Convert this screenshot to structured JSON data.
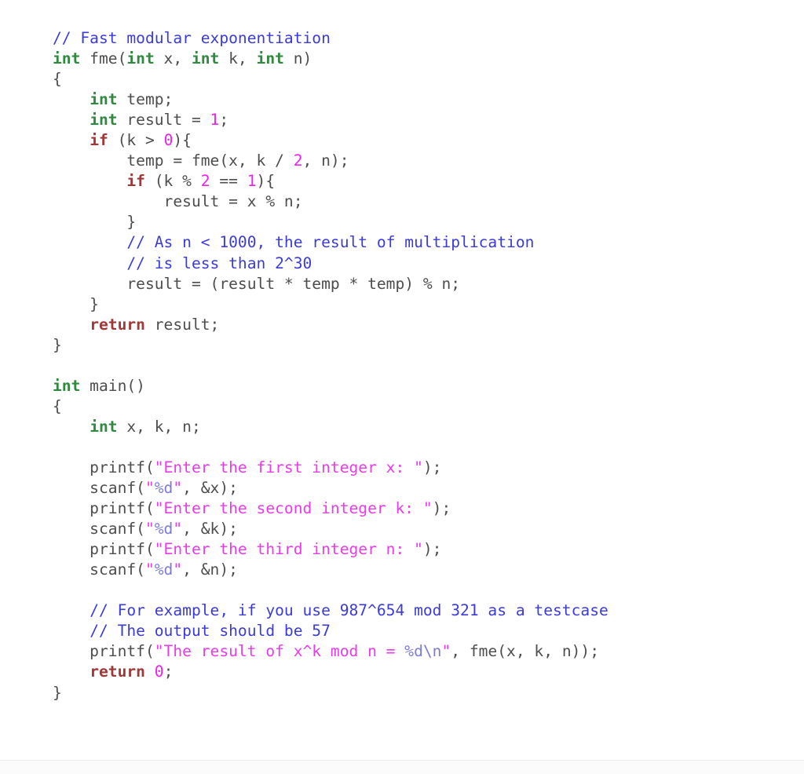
{
  "document": {
    "language": "C",
    "title": "Fast modular exponentiation",
    "background_color": "#ffffff",
    "divider_color": "#ececed",
    "strip_color": "#fbfbfc"
  },
  "theme": {
    "plain": "#4d4d4d",
    "comment": "#3b3bdb",
    "type": "#2f8a3f",
    "keyword": "#a03838",
    "number": "#f020f0",
    "string": "#ea3bea",
    "escape": "#7b7bdb"
  },
  "code": {
    "plain_text": "// Fast modular exponentiation\nint fme(int x, int k, int n)\n{\n    int temp;\n    int result = 1;\n    if (k > 0){\n        temp = fme(x, k / 2, n);\n        if (k % 2 == 1){\n            result = x % n;\n        }\n        // As n < 1000, the result of multiplication\n        // is less than 2^30\n        result = (result * temp * temp) % n;\n    }\n    return result;\n}\n\nint main()\n{\n    int x, k, n;\n\n    printf(\"Enter the first integer x: \");\n    scanf(\"%d\", &x);\n    printf(\"Enter the second integer k: \");\n    scanf(\"%d\", &k);\n    printf(\"Enter the third integer n: \");\n    scanf(\"%d\", &n);\n\n    // For example, if you use 987^654 mod 321 as a testcase\n    // The output should be 57\n    printf(\"The result of x^k mod n = %d\\n\", fme(x, k, n));\n    return 0;\n}",
    "lines": [
      {
        "n": 1,
        "tokens": [
          {
            "t": "comment",
            "s": "// Fast modular exponentiation"
          }
        ]
      },
      {
        "n": 2,
        "tokens": [
          {
            "t": "type",
            "s": "int"
          },
          {
            "t": "plain",
            "s": " fme("
          },
          {
            "t": "type",
            "s": "int"
          },
          {
            "t": "plain",
            "s": " x, "
          },
          {
            "t": "type",
            "s": "int"
          },
          {
            "t": "plain",
            "s": " k, "
          },
          {
            "t": "type",
            "s": "int"
          },
          {
            "t": "plain",
            "s": " n)"
          }
        ]
      },
      {
        "n": 3,
        "tokens": [
          {
            "t": "plain",
            "s": "{"
          }
        ]
      },
      {
        "n": 4,
        "tokens": [
          {
            "t": "plain",
            "s": "    "
          },
          {
            "t": "type",
            "s": "int"
          },
          {
            "t": "plain",
            "s": " temp;"
          }
        ]
      },
      {
        "n": 5,
        "tokens": [
          {
            "t": "plain",
            "s": "    "
          },
          {
            "t": "type",
            "s": "int"
          },
          {
            "t": "plain",
            "s": " result = "
          },
          {
            "t": "number",
            "s": "1"
          },
          {
            "t": "plain",
            "s": ";"
          }
        ]
      },
      {
        "n": 6,
        "tokens": [
          {
            "t": "plain",
            "s": "    "
          },
          {
            "t": "keyword",
            "s": "if"
          },
          {
            "t": "plain",
            "s": " (k > "
          },
          {
            "t": "number",
            "s": "0"
          },
          {
            "t": "plain",
            "s": "){"
          }
        ]
      },
      {
        "n": 7,
        "tokens": [
          {
            "t": "plain",
            "s": "        temp = fme(x, k / "
          },
          {
            "t": "number",
            "s": "2"
          },
          {
            "t": "plain",
            "s": ", n);"
          }
        ]
      },
      {
        "n": 8,
        "tokens": [
          {
            "t": "plain",
            "s": "        "
          },
          {
            "t": "keyword",
            "s": "if"
          },
          {
            "t": "plain",
            "s": " (k % "
          },
          {
            "t": "number",
            "s": "2"
          },
          {
            "t": "plain",
            "s": " == "
          },
          {
            "t": "number",
            "s": "1"
          },
          {
            "t": "plain",
            "s": "){"
          }
        ]
      },
      {
        "n": 9,
        "tokens": [
          {
            "t": "plain",
            "s": "            result = x % n;"
          }
        ]
      },
      {
        "n": 10,
        "tokens": [
          {
            "t": "plain",
            "s": "        }"
          }
        ]
      },
      {
        "n": 11,
        "tokens": [
          {
            "t": "plain",
            "s": "        "
          },
          {
            "t": "comment",
            "s": "// As n < 1000, the result of multiplication"
          }
        ]
      },
      {
        "n": 12,
        "tokens": [
          {
            "t": "plain",
            "s": "        "
          },
          {
            "t": "comment",
            "s": "// is less than 2^30"
          }
        ]
      },
      {
        "n": 13,
        "tokens": [
          {
            "t": "plain",
            "s": "        result = (result * temp * temp) % n;"
          }
        ]
      },
      {
        "n": 14,
        "tokens": [
          {
            "t": "plain",
            "s": "    }"
          }
        ]
      },
      {
        "n": 15,
        "tokens": [
          {
            "t": "plain",
            "s": "    "
          },
          {
            "t": "keyword",
            "s": "return"
          },
          {
            "t": "plain",
            "s": " result;"
          }
        ]
      },
      {
        "n": 16,
        "tokens": [
          {
            "t": "plain",
            "s": "}"
          }
        ]
      },
      {
        "n": 17,
        "tokens": [
          {
            "t": "plain",
            "s": ""
          }
        ]
      },
      {
        "n": 18,
        "tokens": [
          {
            "t": "type",
            "s": "int"
          },
          {
            "t": "plain",
            "s": " main()"
          }
        ]
      },
      {
        "n": 19,
        "tokens": [
          {
            "t": "plain",
            "s": "{"
          }
        ]
      },
      {
        "n": 20,
        "tokens": [
          {
            "t": "plain",
            "s": "    "
          },
          {
            "t": "type",
            "s": "int"
          },
          {
            "t": "plain",
            "s": " x, k, n;"
          }
        ]
      },
      {
        "n": 21,
        "tokens": [
          {
            "t": "plain",
            "s": ""
          }
        ]
      },
      {
        "n": 22,
        "tokens": [
          {
            "t": "plain",
            "s": "    printf("
          },
          {
            "t": "string",
            "s": "\"Enter the first integer x: \""
          },
          {
            "t": "plain",
            "s": ");"
          }
        ]
      },
      {
        "n": 23,
        "tokens": [
          {
            "t": "plain",
            "s": "    scanf("
          },
          {
            "t": "string",
            "s": "\""
          },
          {
            "t": "escape",
            "s": "%d"
          },
          {
            "t": "string",
            "s": "\""
          },
          {
            "t": "plain",
            "s": ", &x);"
          }
        ]
      },
      {
        "n": 24,
        "tokens": [
          {
            "t": "plain",
            "s": "    printf("
          },
          {
            "t": "string",
            "s": "\"Enter the second integer k: \""
          },
          {
            "t": "plain",
            "s": ");"
          }
        ]
      },
      {
        "n": 25,
        "tokens": [
          {
            "t": "plain",
            "s": "    scanf("
          },
          {
            "t": "string",
            "s": "\""
          },
          {
            "t": "escape",
            "s": "%d"
          },
          {
            "t": "string",
            "s": "\""
          },
          {
            "t": "plain",
            "s": ", &k);"
          }
        ]
      },
      {
        "n": 26,
        "tokens": [
          {
            "t": "plain",
            "s": "    printf("
          },
          {
            "t": "string",
            "s": "\"Enter the third integer n: \""
          },
          {
            "t": "plain",
            "s": ");"
          }
        ]
      },
      {
        "n": 27,
        "tokens": [
          {
            "t": "plain",
            "s": "    scanf("
          },
          {
            "t": "string",
            "s": "\""
          },
          {
            "t": "escape",
            "s": "%d"
          },
          {
            "t": "string",
            "s": "\""
          },
          {
            "t": "plain",
            "s": ", &n);"
          }
        ]
      },
      {
        "n": 28,
        "tokens": [
          {
            "t": "plain",
            "s": ""
          }
        ]
      },
      {
        "n": 29,
        "tokens": [
          {
            "t": "plain",
            "s": "    "
          },
          {
            "t": "comment",
            "s": "// For example, if you use 987^654 mod 321 as a testcase"
          }
        ]
      },
      {
        "n": 30,
        "tokens": [
          {
            "t": "plain",
            "s": "    "
          },
          {
            "t": "comment",
            "s": "// The output should be 57"
          }
        ]
      },
      {
        "n": 31,
        "tokens": [
          {
            "t": "plain",
            "s": "    printf("
          },
          {
            "t": "string",
            "s": "\"The result of x^k mod n = "
          },
          {
            "t": "escape",
            "s": "%d\\n"
          },
          {
            "t": "string",
            "s": "\""
          },
          {
            "t": "plain",
            "s": ", fme(x, k, n));"
          }
        ]
      },
      {
        "n": 32,
        "tokens": [
          {
            "t": "plain",
            "s": "    "
          },
          {
            "t": "keyword",
            "s": "return"
          },
          {
            "t": "plain",
            "s": " "
          },
          {
            "t": "number",
            "s": "0"
          },
          {
            "t": "plain",
            "s": ";"
          }
        ]
      },
      {
        "n": 33,
        "tokens": [
          {
            "t": "plain",
            "s": "}"
          }
        ]
      }
    ]
  }
}
